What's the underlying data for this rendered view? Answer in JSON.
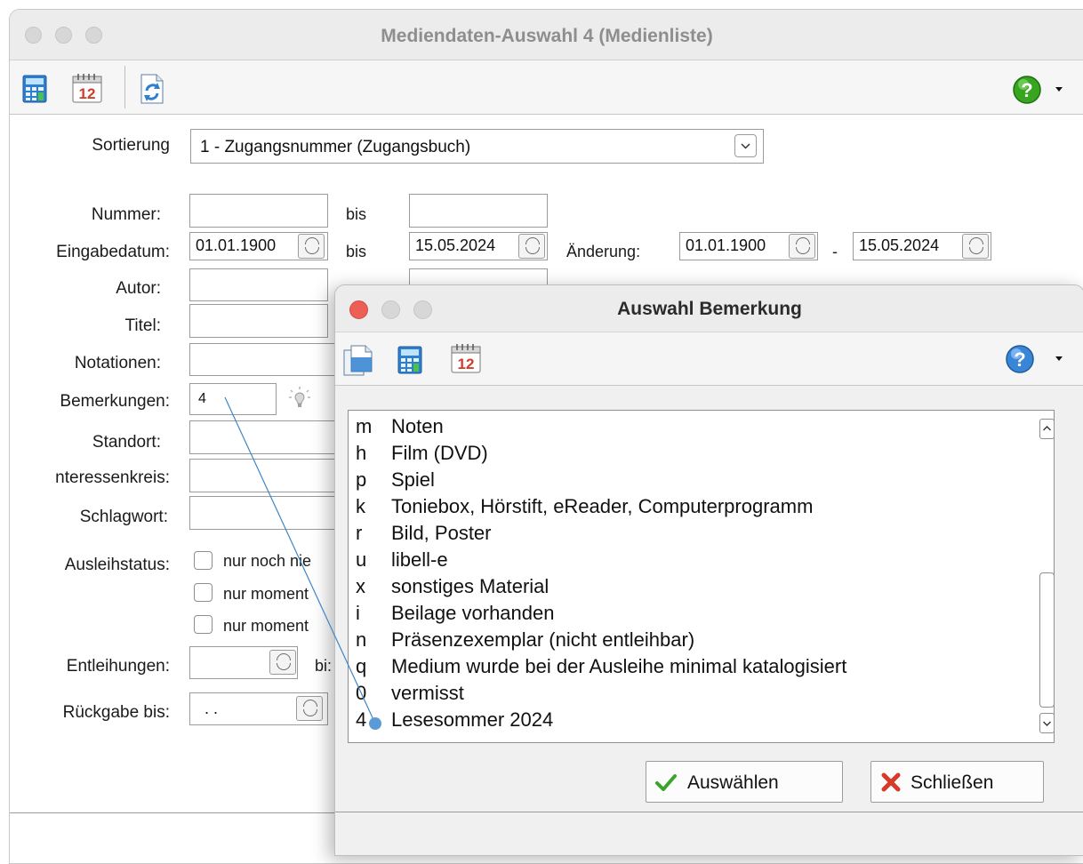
{
  "main_window": {
    "title": "Mediendaten-Auswahl 4 (Medienliste)",
    "form": {
      "sort_label": "Sortierung",
      "sort_value": "1 - Zugangsnummer (Zugangsbuch)",
      "nummer_label": "Nummer:",
      "bis": "bis",
      "eingabedatum_label": "Eingabedatum:",
      "eingabedatum_from": "01.01.1900",
      "eingabedatum_to": "15.05.2024",
      "aenderung_label": "Änderung:",
      "aenderung_from": "01.01.1900",
      "aenderung_dash": "-",
      "aenderung_to": "15.05.2024",
      "autor_label": "Autor:",
      "titel_label": "Titel:",
      "notationen_label": "Notationen:",
      "bemerkungen_label": "Bemerkungen:",
      "bemerkungen_value": "4",
      "standort_label": "Standort:",
      "interessenkreis_label": "nteressenkreis:",
      "schlagwort_label": "Schlagwort:",
      "ausleihstatus_label": "Ausleihstatus:",
      "status_options": [
        "nur noch nie",
        "nur moment",
        "nur moment"
      ],
      "entleihungen_label": "Entleihungen:",
      "entleihungen_bis": "bi:",
      "rueckgabe_label": "Rückgabe bis:",
      "rueckgabe_value": ". ."
    }
  },
  "dialog": {
    "title": "Auswahl Bemerkung",
    "items": [
      {
        "key": "m",
        "text": "Noten"
      },
      {
        "key": "h",
        "text": "Film (DVD)"
      },
      {
        "key": "p",
        "text": "Spiel"
      },
      {
        "key": "k",
        "text": "Toniebox, Hörstift, eReader, Computerprogramm"
      },
      {
        "key": "r",
        "text": "Bild, Poster"
      },
      {
        "key": "u",
        "text": "libell-e"
      },
      {
        "key": "x",
        "text": "sonstiges Material"
      },
      {
        "key": "i",
        "text": "Beilage vorhanden"
      },
      {
        "key": "n",
        "text": "Präsenzexemplar (nicht entleihbar)"
      },
      {
        "key": "q",
        "text": "Medium wurde bei der Ausleihe minimal katalogisiert"
      },
      {
        "key": "0",
        "text": "vermisst"
      },
      {
        "key": "4",
        "text": "Lesesommer 2024"
      }
    ],
    "select_button": "Auswählen",
    "close_button": "Schließen"
  },
  "colors": {
    "close_red": "#ec5f57",
    "link_line": "#3f86c7",
    "cursor_dot": "#5b9bd5"
  }
}
